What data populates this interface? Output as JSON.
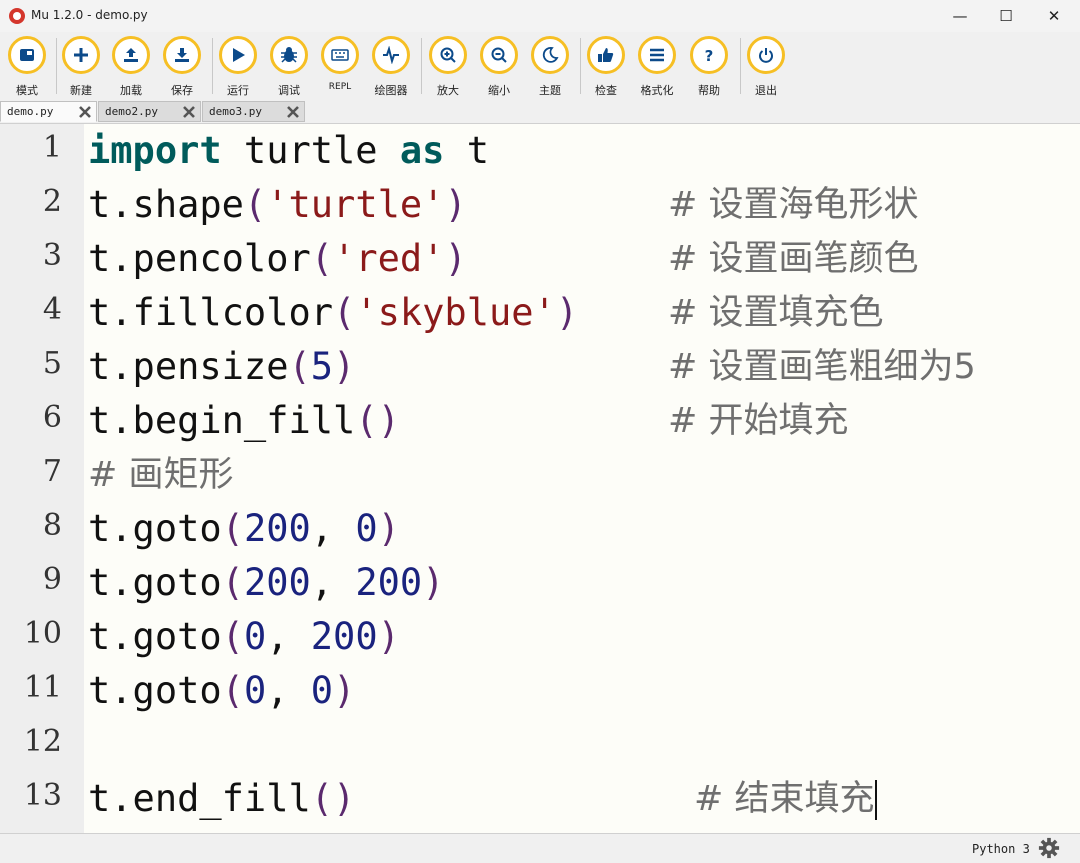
{
  "window": {
    "title": "Mu 1.2.0 - demo.py",
    "minimize_glyph": "—",
    "maximize_glyph": "☐",
    "close_glyph": "✕"
  },
  "toolbar": {
    "accent": "#f6bf24",
    "buttons": [
      {
        "label": "模式",
        "icon": "mode-icon"
      },
      {
        "label": "新建",
        "icon": "plus-icon"
      },
      {
        "label": "加载",
        "icon": "upload-icon"
      },
      {
        "label": "保存",
        "icon": "download-icon"
      },
      {
        "label": "运行",
        "icon": "play-icon"
      },
      {
        "label": "调试",
        "icon": "bug-icon"
      },
      {
        "label": "REPL",
        "icon": "keyboard-icon"
      },
      {
        "label": "绘图器",
        "icon": "wave-icon"
      },
      {
        "label": "放大",
        "icon": "zoom-in-icon"
      },
      {
        "label": "缩小",
        "icon": "zoom-out-icon"
      },
      {
        "label": "主题",
        "icon": "moon-icon"
      },
      {
        "label": "检查",
        "icon": "thumbs-up-icon"
      },
      {
        "label": "格式化",
        "icon": "lines-icon"
      },
      {
        "label": "帮助",
        "icon": "question-icon"
      },
      {
        "label": "退出",
        "icon": "power-icon"
      }
    ]
  },
  "tabs": [
    {
      "label": "demo.py",
      "active": true
    },
    {
      "label": "demo2.py",
      "active": false
    },
    {
      "label": "demo3.py",
      "active": false
    }
  ],
  "editor": {
    "lines": [
      {
        "n": "1",
        "code": "import turtle as t",
        "comment": ""
      },
      {
        "n": "2",
        "code": "t.shape('turtle')",
        "comment": "# 设置海龟形状"
      },
      {
        "n": "3",
        "code": "t.pencolor('red')",
        "comment": "# 设置画笔颜色"
      },
      {
        "n": "4",
        "code": "t.fillcolor('skyblue')",
        "comment": "# 设置填充色"
      },
      {
        "n": "5",
        "code": "t.pensize(5)",
        "comment": "# 设置画笔粗细为5"
      },
      {
        "n": "6",
        "code": "t.begin_fill()",
        "comment": "# 开始填充"
      },
      {
        "n": "7",
        "code": "",
        "comment": "# 画矩形"
      },
      {
        "n": "8",
        "code": "t.goto(200, 0)",
        "comment": ""
      },
      {
        "n": "9",
        "code": "t.goto(200, 200)",
        "comment": ""
      },
      {
        "n": "10",
        "code": "t.goto(0, 200)",
        "comment": ""
      },
      {
        "n": "11",
        "code": "t.goto(0, 0)",
        "comment": ""
      },
      {
        "n": "12",
        "code": "",
        "comment": ""
      },
      {
        "n": "13",
        "code": "t.end_fill()",
        "comment": "# 结束填充"
      }
    ]
  },
  "status": {
    "mode": "Python 3",
    "settings_icon": "gear-icon"
  }
}
